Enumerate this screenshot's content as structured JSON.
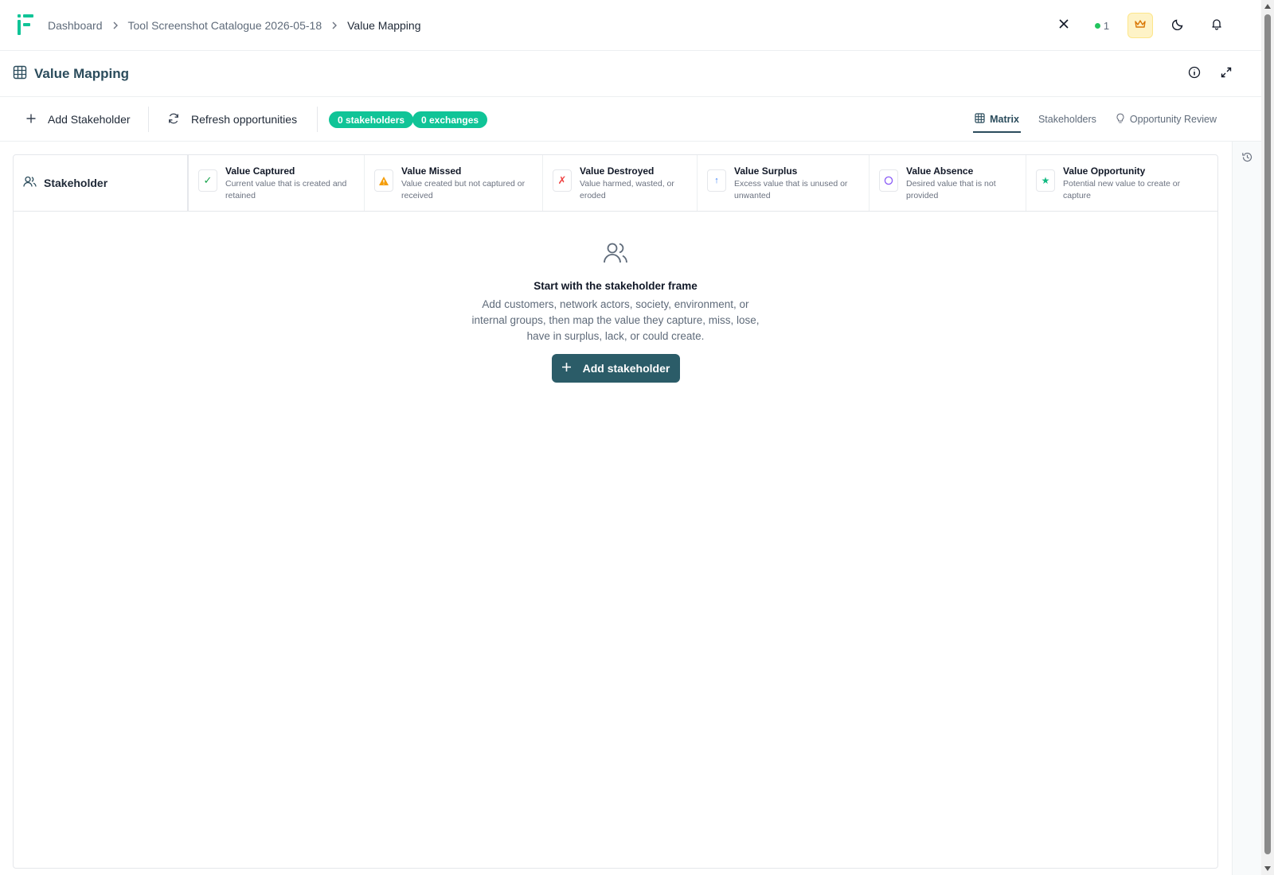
{
  "breadcrumb": {
    "items": [
      "Dashboard",
      "Tool Screenshot Catalogue 2026-05-18",
      "Value Mapping"
    ]
  },
  "topbar": {
    "online_count": "1"
  },
  "page": {
    "title": "Value Mapping"
  },
  "toolbar": {
    "add_label": "Add Stakeholder",
    "refresh_label": "Refresh opportunities",
    "stakeholders_pill": "0 stakeholders",
    "exchanges_pill": "0 exchanges",
    "views": [
      "Matrix",
      "Stakeholders",
      "Opportunity Review"
    ],
    "active_view": "Matrix"
  },
  "matrix": {
    "stakeholder_header": "Stakeholder",
    "columns": [
      {
        "title": "Value Captured",
        "desc": "Current value that is created and retained",
        "icon": "check-icon",
        "color": "#16a34a"
      },
      {
        "title": "Value Missed",
        "desc": "Value created but not captured or received",
        "icon": "warning-icon",
        "color": "#f59e0b"
      },
      {
        "title": "Value Destroyed",
        "desc": "Value harmed, wasted, or eroded",
        "icon": "cross-icon",
        "color": "#ef4444"
      },
      {
        "title": "Value Surplus",
        "desc": "Excess value that is unused or unwanted",
        "icon": "arrow-up-icon",
        "color": "#3b82f6"
      },
      {
        "title": "Value Absence",
        "desc": "Desired value that is not provided",
        "icon": "circle-icon",
        "color": "#8b5cf6"
      },
      {
        "title": "Value Opportunity",
        "desc": "Potential new value to create or capture",
        "icon": "star-icon",
        "color": "#10b981"
      }
    ]
  },
  "empty_state": {
    "title": "Start with the stakeholder frame",
    "description": "Add customers, network actors, society, environment, or internal groups, then map the value they capture, miss, lose, have in surplus, lack, or could create.",
    "button_label": "Add stakeholder"
  },
  "colors": {
    "brand": "#10c497",
    "primary": "#2b5c68",
    "title": "#2b4c5c"
  }
}
